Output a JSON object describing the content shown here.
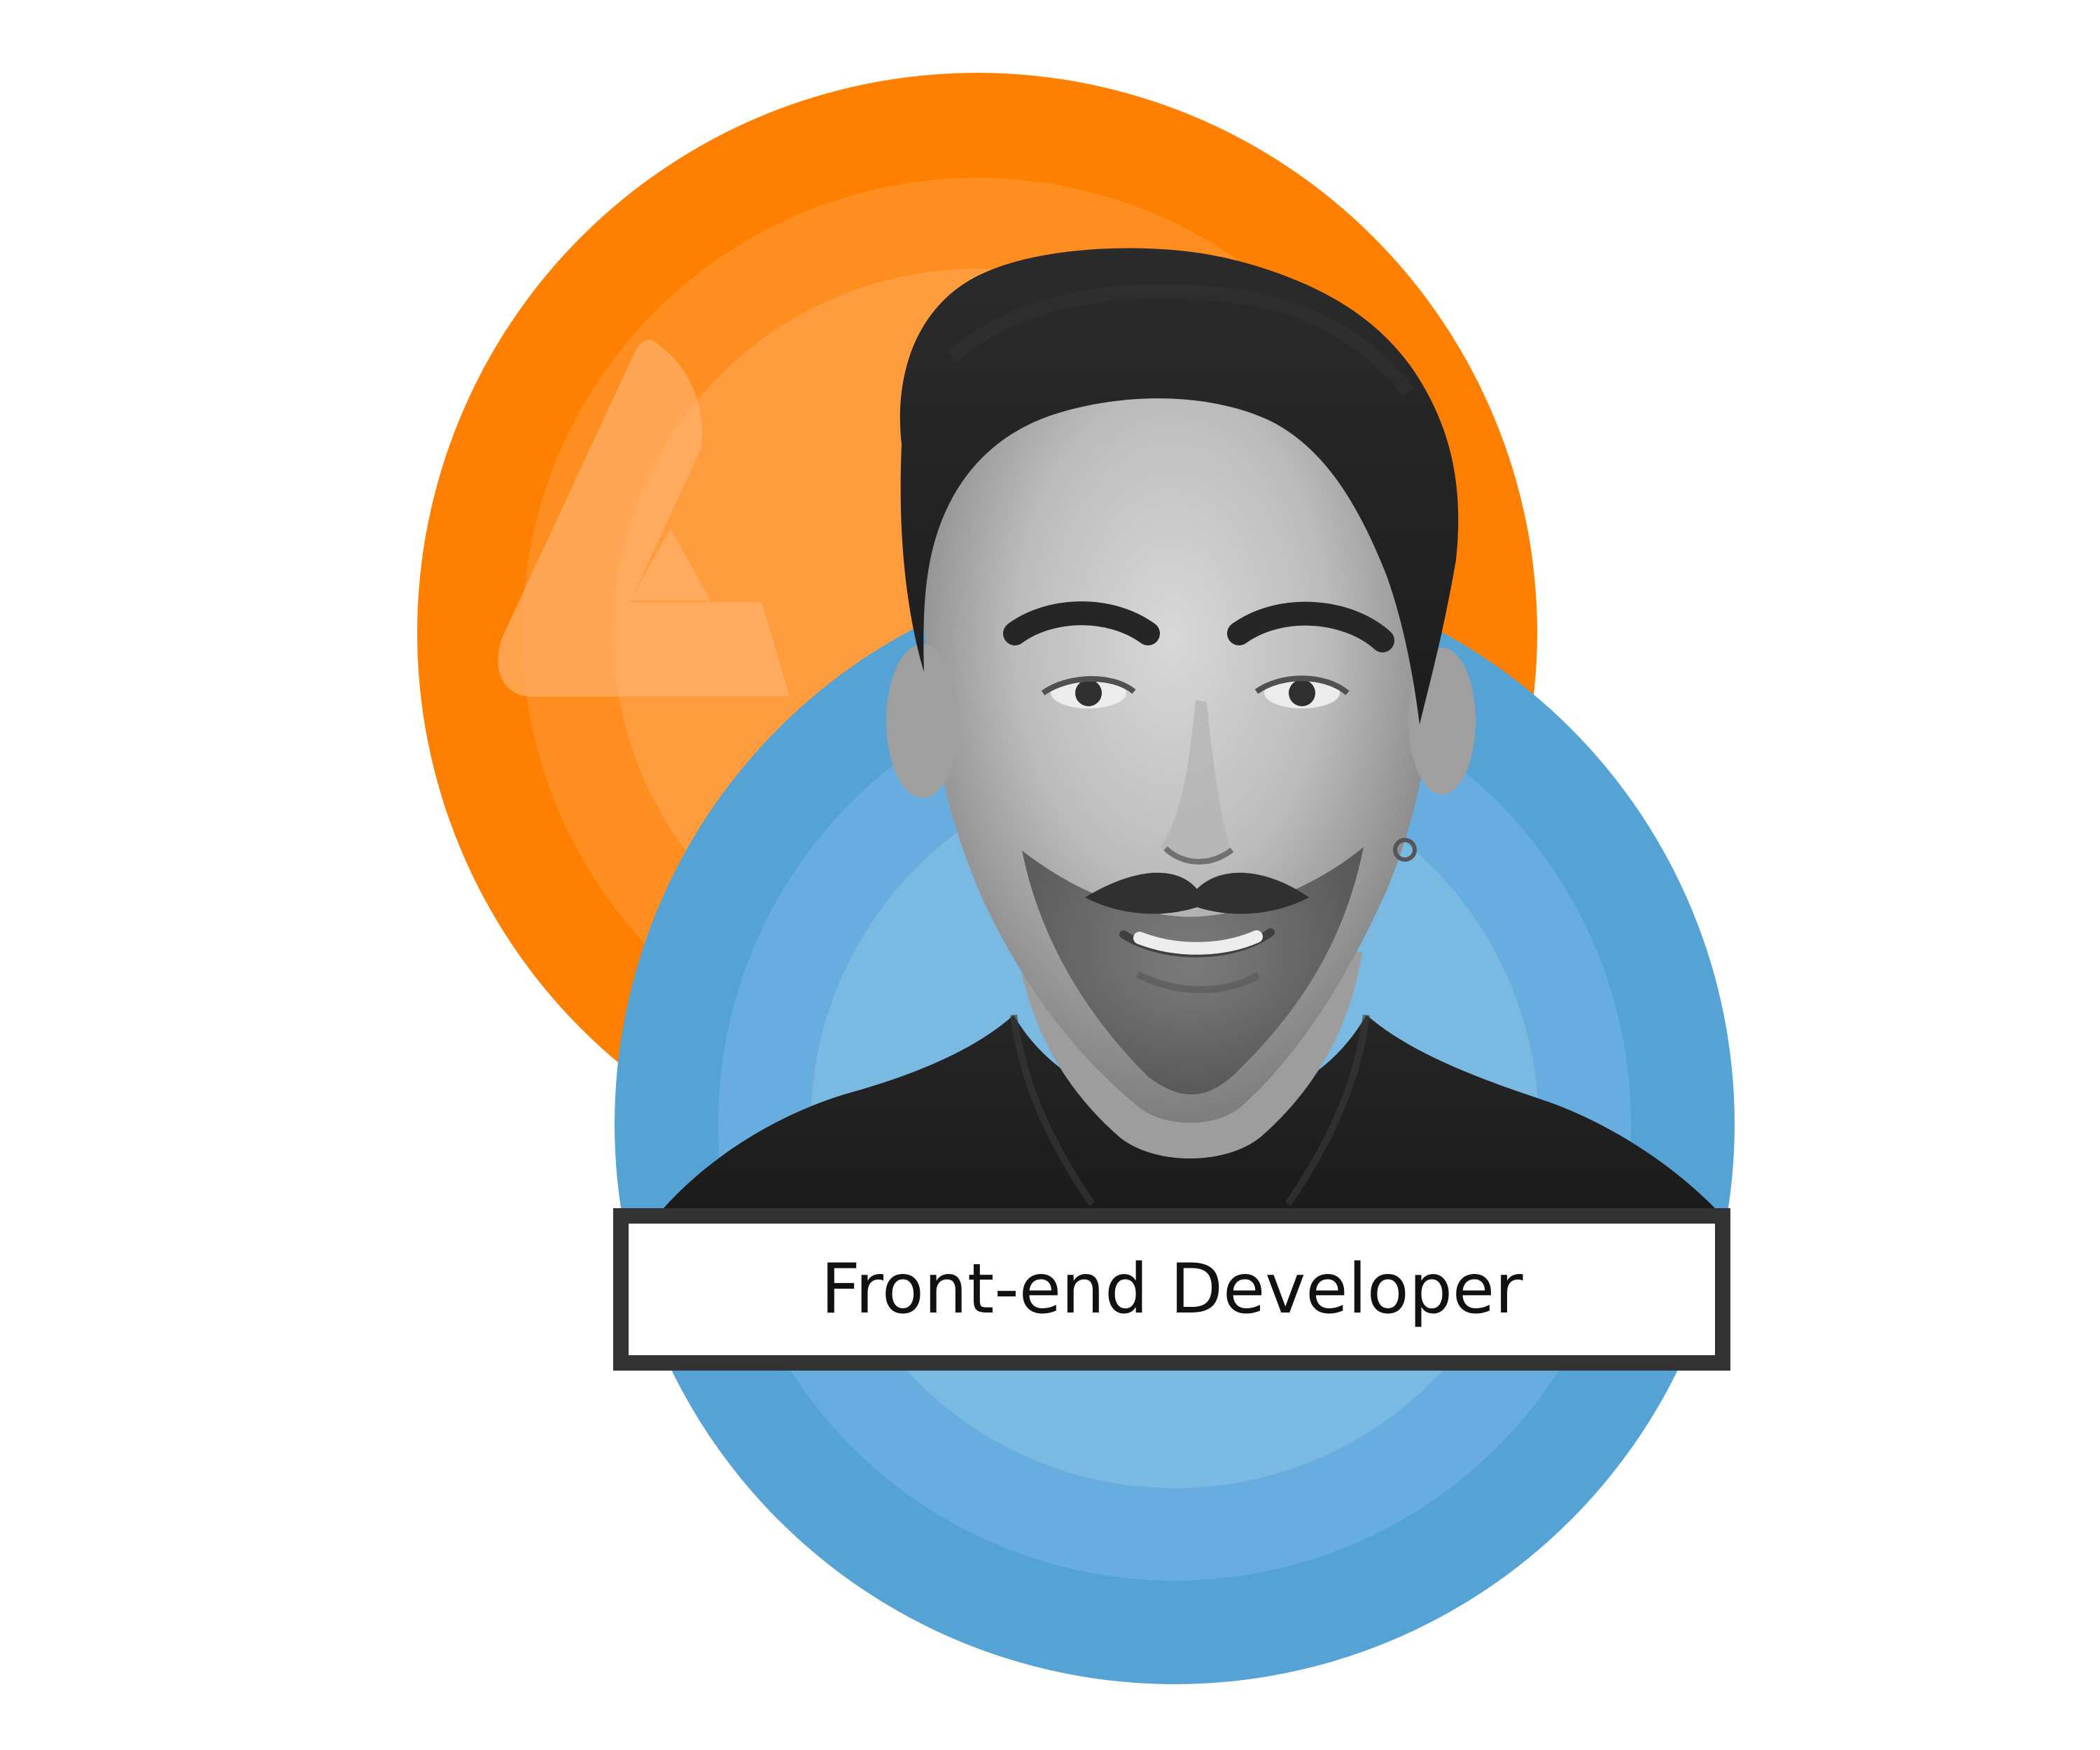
{
  "badge": {
    "role": "Front-end Developer"
  },
  "colors": {
    "orange_outer": "#ff7f00",
    "orange_inner": "#ffb06a",
    "blue_outer": "#55a2d5",
    "blue_inner": "#7ab9e0",
    "badge_border": "#333333",
    "photo_grayscale_dark": "#1f1f1f",
    "photo_grayscale_light": "#cfcfcf"
  },
  "icons": {
    "logo": "triangle-a-logo-icon",
    "portrait": "person-photo"
  }
}
